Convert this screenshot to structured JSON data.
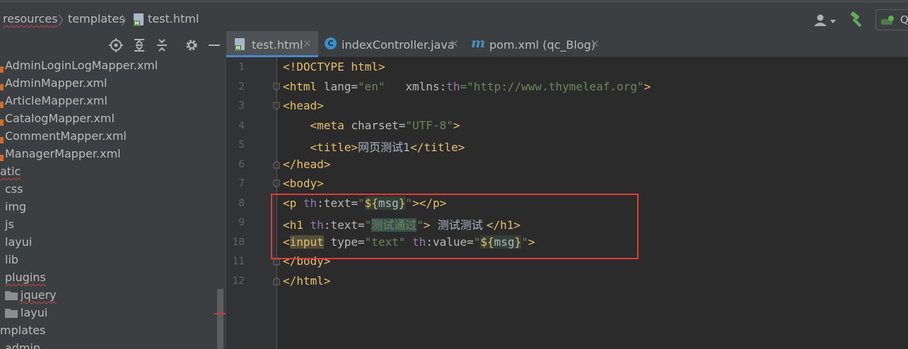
{
  "breadcrumb": {
    "items": [
      "resources",
      "templates",
      "test.html"
    ]
  },
  "toolbar": {
    "run_config_label": "Q"
  },
  "project_tree": {
    "items": [
      {
        "label": "AdminLoginLogMapper.xml",
        "type": "xml"
      },
      {
        "label": "AdminMapper.xml",
        "type": "xml"
      },
      {
        "label": "ArticleMapper.xml",
        "type": "xml"
      },
      {
        "label": "CatalogMapper.xml",
        "type": "xml"
      },
      {
        "label": "CommentMapper.xml",
        "type": "xml"
      },
      {
        "label": "ManagerMapper.xml",
        "type": "xml"
      },
      {
        "label": "atic",
        "type": "folder"
      },
      {
        "label": "css",
        "type": "folder"
      },
      {
        "label": "img",
        "type": "folder"
      },
      {
        "label": "js",
        "type": "folder"
      },
      {
        "label": "layui",
        "type": "folder"
      },
      {
        "label": "lib",
        "type": "folder"
      },
      {
        "label": "plugins",
        "type": "folder"
      },
      {
        "label": "jquery",
        "type": "folder"
      },
      {
        "label": "layui",
        "type": "folder"
      },
      {
        "label": "mplates",
        "type": "folder"
      },
      {
        "label": "admin",
        "type": "folder"
      }
    ]
  },
  "tabs": [
    {
      "label": "test.html",
      "active": true
    },
    {
      "label": "indexController.java",
      "active": false
    },
    {
      "label": "pom.xml (qc_Blog)",
      "active": false
    }
  ],
  "line_numbers": [
    "1",
    "2",
    "3",
    "4",
    "5",
    "6",
    "7",
    "8",
    "9",
    "10",
    "11",
    "12"
  ],
  "code": {
    "l1": {
      "t1": "<!DOCTYPE html>"
    },
    "l2": {
      "t1": "<html",
      "a1": " lang=",
      "s1": "\"en\"",
      "sp": "   ",
      "ns1": "xmlns:",
      "ns2": "th",
      "s2": "=\"http://www.thymeleaf.org\"",
      "t2": ">"
    },
    "l3": {
      "t1": "<head>"
    },
    "l4": {
      "indent": "    ",
      "t1": "<meta",
      "a1": " charset=",
      "s1": "\"UTF-8\"",
      "t2": ">"
    },
    "l5": {
      "indent": "    ",
      "t1": "<title>",
      "txt": "网页测试1",
      "t2": "</title>"
    },
    "l6": {
      "t1": "</head>"
    },
    "l7": {
      "t1": "<body>"
    },
    "l8": {
      "t1": "<p",
      "ns1": " th",
      "a1": ":text=",
      "s1": "\"",
      "e1": "${",
      "e2": "msg",
      "e3": "}",
      "s2": "\"",
      "t2": "></p>"
    },
    "l9": {
      "t1": "<h1",
      "ns1": " th",
      "a1": ":text=",
      "s1": "\"",
      "cn": "测试通过",
      "s2": "\"",
      "t2": ">",
      "txt": "  测试测试 ",
      "t3": "</h1>"
    },
    "l10": {
      "t1": "<",
      "t1b": "input",
      "a1": " type=",
      "s1": "\"text\"",
      "ns1": " th",
      "a2": ":value=",
      "s2": "\"",
      "e1": "${",
      "e2": "msg",
      "e3": "}",
      "s3": "\"",
      "t2": ">"
    },
    "l11": {
      "t1": "</body>"
    },
    "l12": {
      "t1": "</html>"
    }
  },
  "colors": {
    "background": "#2b2b2b",
    "panel": "#3c3f41",
    "tag": "#e8bf6a",
    "string": "#6a8759",
    "namespace": "#9876aa",
    "highlight_box": "#e03b3b"
  }
}
